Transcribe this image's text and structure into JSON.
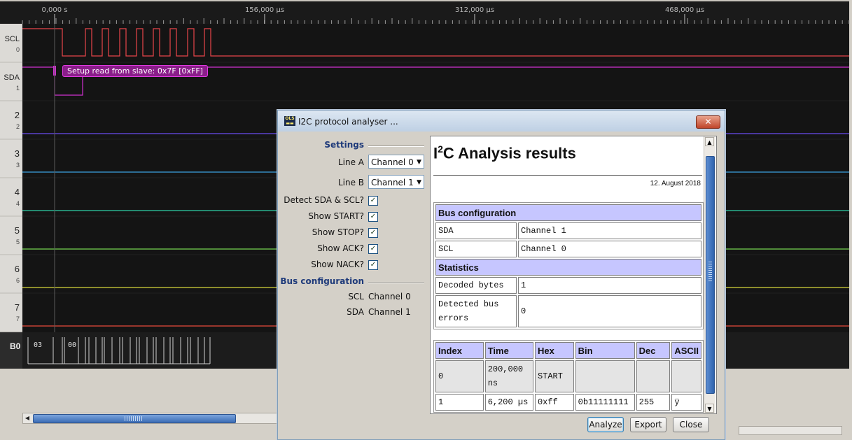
{
  "timeline": {
    "ticks": [
      "0,000 s",
      "156,000 µs",
      "312,000 µs",
      "468,000 µs"
    ]
  },
  "channels": [
    {
      "name": "SCL",
      "index": "0"
    },
    {
      "name": "SDA",
      "index": "1"
    },
    {
      "name": "2",
      "index": "2"
    },
    {
      "name": "3",
      "index": "3"
    },
    {
      "name": "4",
      "index": "4"
    },
    {
      "name": "5",
      "index": "5"
    },
    {
      "name": "6",
      "index": "6"
    },
    {
      "name": "7",
      "index": "7"
    }
  ],
  "bus_row": {
    "label": "B0",
    "values": [
      "03",
      "00"
    ]
  },
  "annotation": "Setup read from slave: 0x7F [0xFF]",
  "colors": {
    "scl": "#e8454a",
    "sda": "#d130d1",
    "ch2": "#6b4cf0",
    "ch3": "#3aa0e0",
    "ch4": "#2fd0a8",
    "ch5": "#76d352",
    "ch6": "#d8d83a",
    "ch7": "#e84a3a"
  },
  "dialog": {
    "title": "I2C protocol analyser ...",
    "close_icon": "close-icon",
    "settings": {
      "heading": "Settings",
      "line_a_label": "Line A",
      "line_a_value": "Channel 0",
      "line_b_label": "Line B",
      "line_b_value": "Channel 1",
      "checkboxes": [
        "Detect SDA & SCL?",
        "Show START?",
        "Show STOP?",
        "Show ACK?",
        "Show NACK?"
      ]
    },
    "bus_config": {
      "heading": "Bus configuration",
      "scl_label": "SCL",
      "scl_value": "Channel 0",
      "sda_label": "SDA",
      "sda_value": "Channel 1"
    },
    "report": {
      "title_prefix": "I",
      "title_sup": "2",
      "title_rest": "C Analysis results",
      "date": "12. August 2018",
      "bus_heading": "Bus configuration",
      "bus_rows": [
        [
          "SDA",
          "Channel 1"
        ],
        [
          "SCL",
          "Channel 0"
        ]
      ],
      "stats_heading": "Statistics",
      "stats_rows": [
        [
          "Decoded bytes",
          "1"
        ],
        [
          "Detected bus errors",
          "0"
        ]
      ],
      "columns": [
        "Index",
        "Time",
        "Hex",
        "Bin",
        "Dec",
        "ASCII"
      ],
      "rows": [
        [
          "0",
          "200,000 ns",
          "START",
          "",
          "",
          ""
        ],
        [
          "1",
          "6,200 µs",
          "0xff",
          "0b11111111",
          "255",
          "ÿ"
        ]
      ]
    },
    "buttons": {
      "analyze": "Analyze",
      "export": "Export",
      "close": "Close"
    }
  }
}
